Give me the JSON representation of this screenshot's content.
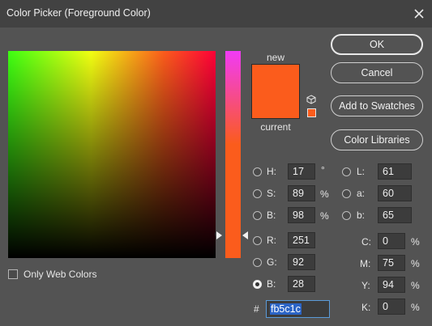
{
  "window": {
    "title": "Color Picker (Foreground Color)"
  },
  "buttons": {
    "ok": "OK",
    "cancel": "Cancel",
    "add_to_swatches": "Add to Swatches",
    "color_libraries": "Color Libraries"
  },
  "preview": {
    "new_label": "new",
    "current_label": "current",
    "color": "#fb5c1c"
  },
  "only_web_colors": {
    "label": "Only Web Colors",
    "checked": false
  },
  "hsb": {
    "h": {
      "label": "H:",
      "value": "17",
      "unit": "°"
    },
    "s": {
      "label": "S:",
      "value": "89",
      "unit": "%"
    },
    "b": {
      "label": "B:",
      "value": "98",
      "unit": "%"
    }
  },
  "rgb": {
    "r": {
      "label": "R:",
      "value": "251"
    },
    "g": {
      "label": "G:",
      "value": "92"
    },
    "b": {
      "label": "B:",
      "value": "28",
      "selected": true
    }
  },
  "lab": {
    "l": {
      "label": "L:",
      "value": "61"
    },
    "a": {
      "label": "a:",
      "value": "60"
    },
    "b": {
      "label": "b:",
      "value": "65"
    }
  },
  "cmyk": {
    "c": {
      "label": "C:",
      "value": "0",
      "unit": "%"
    },
    "m": {
      "label": "M:",
      "value": "75",
      "unit": "%"
    },
    "y": {
      "label": "Y:",
      "value": "94",
      "unit": "%"
    },
    "k": {
      "label": "K:",
      "value": "0",
      "unit": "%"
    }
  },
  "hex": {
    "label": "#",
    "value": "fb5c1c"
  }
}
